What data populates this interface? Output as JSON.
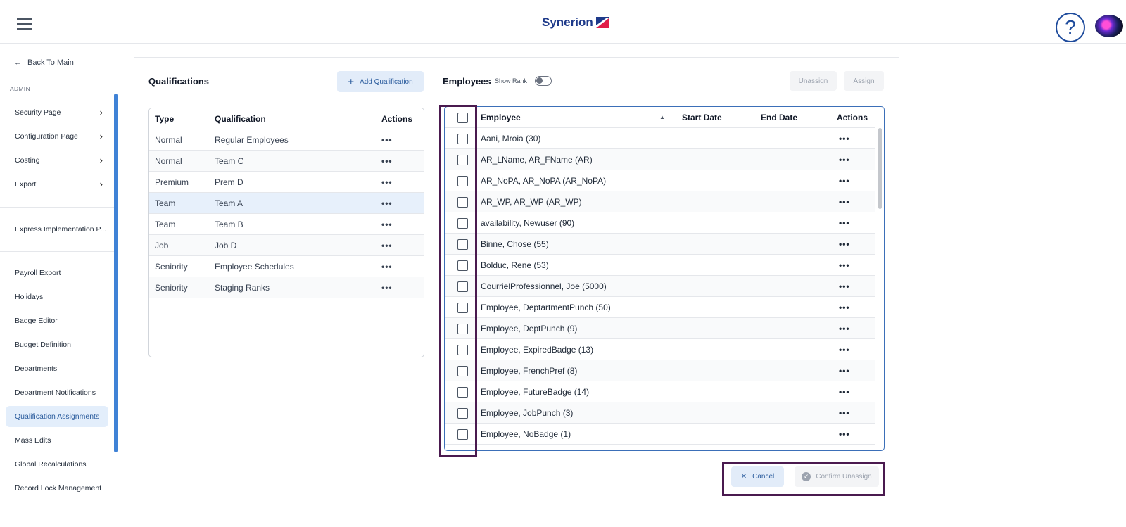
{
  "app": {
    "logo": "Synerion"
  },
  "header": {
    "help_icon": "question-circle-icon",
    "menu_icon": "hamburger-icon"
  },
  "sidebar": {
    "back_label": "Back To Main",
    "section_label": "ADMIN",
    "group1": [
      {
        "label": "Security Page",
        "chevron": "›"
      },
      {
        "label": "Configuration Page",
        "chevron": "›"
      },
      {
        "label": "Costing",
        "chevron": "›"
      },
      {
        "label": "Export",
        "chevron": "›"
      }
    ],
    "express": "Express Implementation P...",
    "group2": [
      {
        "label": "Payroll Export"
      },
      {
        "label": "Holidays"
      },
      {
        "label": "Badge Editor"
      },
      {
        "label": "Budget Definition"
      },
      {
        "label": "Departments"
      },
      {
        "label": "Department Notifications"
      },
      {
        "label": "Qualification Assignments",
        "active": true
      },
      {
        "label": "Mass Edits"
      },
      {
        "label": "Global Recalculations"
      },
      {
        "label": "Record Lock Management"
      }
    ]
  },
  "qualifications": {
    "title": "Qualifications",
    "add_button": "Add Qualification",
    "columns": [
      "Type",
      "Qualification",
      "Actions"
    ],
    "rows": [
      {
        "type": "Normal",
        "qualification": "Regular Employees",
        "actions": "•••"
      },
      {
        "type": "Normal",
        "qualification": "Team C",
        "actions": "•••"
      },
      {
        "type": "Premium",
        "qualification": "Prem D",
        "actions": "•••"
      },
      {
        "type": "Team",
        "qualification": "Team A",
        "actions": "•••"
      },
      {
        "type": "Team",
        "qualification": "Team B",
        "actions": "•••"
      },
      {
        "type": "Job",
        "qualification": "Job D",
        "actions": "•••"
      },
      {
        "type": "Seniority",
        "qualification": "Employee Schedules",
        "actions": "•••"
      },
      {
        "type": "Seniority",
        "qualification": "Staging Ranks",
        "actions": "•••"
      }
    ]
  },
  "employees": {
    "title": "Employees",
    "show_rank_label": "Show Rank",
    "unassign_button": "Unassign",
    "assign_button": "Assign",
    "columns": [
      "Employee",
      "Start Date",
      "End Date",
      "Actions"
    ],
    "sort_indicator": "▲",
    "rows": [
      {
        "name": "Aani, Mroia (30)",
        "actions": "•••"
      },
      {
        "name": "AR_LName, AR_FName (AR)",
        "actions": "•••"
      },
      {
        "name": "AR_NoPA, AR_NoPA (AR_NoPA)",
        "actions": "•••"
      },
      {
        "name": "AR_WP, AR_WP (AR_WP)",
        "actions": "•••"
      },
      {
        "name": "availability, Newuser (90)",
        "actions": "•••"
      },
      {
        "name": "Binne, Chose (55)",
        "actions": "•••"
      },
      {
        "name": "Bolduc, Rene (53)",
        "actions": "•••"
      },
      {
        "name": "CourrielProfessionnel, Joe (5000)",
        "actions": "•••"
      },
      {
        "name": "Employee, DeptartmentPunch (50)",
        "actions": "•••"
      },
      {
        "name": "Employee, DeptPunch (9)",
        "actions": "•••"
      },
      {
        "name": "Employee, ExpiredBadge (13)",
        "actions": "•••"
      },
      {
        "name": "Employee, FrenchPref (8)",
        "actions": "•••"
      },
      {
        "name": "Employee, FutureBadge (14)",
        "actions": "•••"
      },
      {
        "name": "Employee, JobPunch (3)",
        "actions": "•••"
      },
      {
        "name": "Employee, NoBadge (1)",
        "actions": "•••"
      }
    ]
  },
  "footer_actions": {
    "cancel": "Cancel",
    "confirm": "Confirm Unassign"
  },
  "colors": {
    "accent": "#2c5d9e",
    "highlight_border": "#4a1a4f",
    "selected_row": "#e7f0fb"
  }
}
